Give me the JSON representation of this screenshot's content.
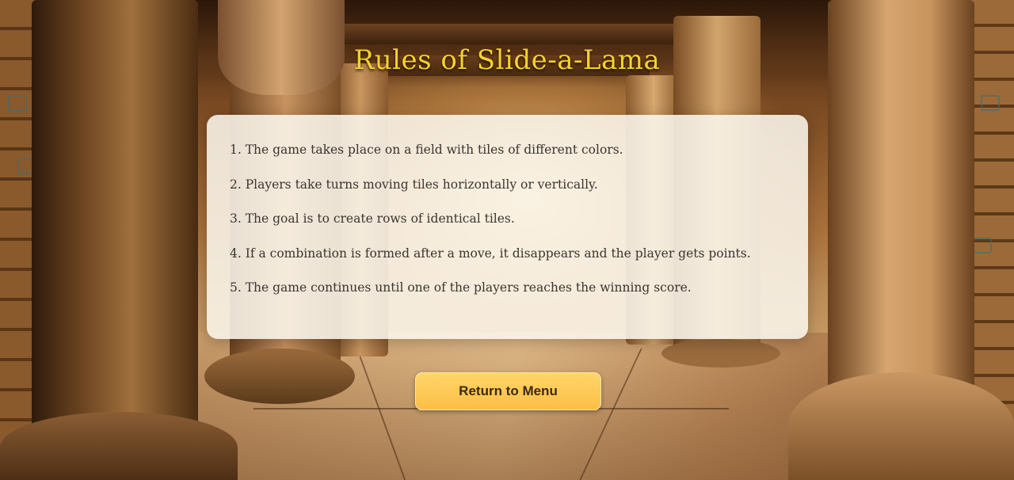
{
  "game": {
    "title": "Rules of Slide-a-Lama",
    "rules": [
      "1. The game takes place on a field with tiles of different colors.",
      "2. Players take turns moving tiles horizontally or vertically.",
      "3. The goal is to create rows of identical tiles.",
      "4. If a combination is formed after a move, it disappears and the player gets points.",
      "5. The game continues until one of the players reaches the winning score."
    ],
    "return_button_label": "Return to Menu"
  },
  "colors": {
    "title": "#f4d22c",
    "panel": "#faf6ec",
    "button": "#fbbe45",
    "text": "#3a3530"
  }
}
